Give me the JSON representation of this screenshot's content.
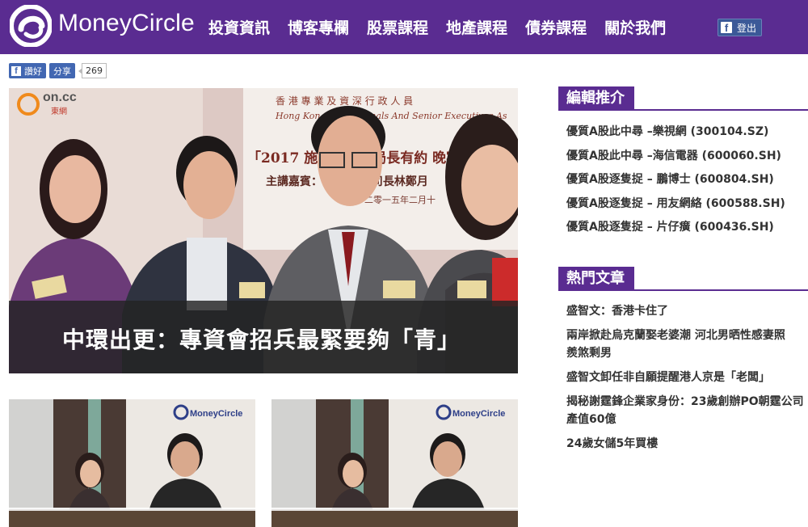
{
  "header": {
    "logo_text": "MoneyCircle",
    "nav": [
      "投資資訊",
      "博客專欄",
      "股票課程",
      "地產課程",
      "債券課程",
      "關於我們"
    ],
    "login_label": "登出"
  },
  "social": {
    "like_label": "讚好",
    "share_label": "分享",
    "share_count": "269"
  },
  "hero": {
    "title": "中環出更：專資會招兵最緊要夠「青」",
    "source_logo": "on.cc",
    "source_sub": "東網",
    "banner_line1": "香 港 專 業 及 資 深 行 政 人 員",
    "banner_line2": "Hong Kong Professionals And Senior Executives As",
    "banner_line3": "「2017 施政報告」局長有約 晚宴",
    "banner_line4": "主講嘉賓：行政長官 司長林鄭月",
    "banner_line5": "二零一五年二月十"
  },
  "thumbnails": [
    {
      "brand": "MoneyCircle"
    },
    {
      "brand": "MoneyCircle"
    }
  ],
  "sidebar": {
    "editor_title": "編輯推介",
    "editor_items": [
      "優質A股此中尋 –樂視網 (300104.SZ)",
      "優質A股此中尋 –海信電器 (600060.SH)",
      "優質A股逐隻捉 – 鵬博士 (600804.SH)",
      "優質A股逐隻捉 – 用友網絡 (600588.SH)",
      "優質A股逐隻捉 – 片仔癀 (600436.SH)"
    ],
    "hot_title": "熱門文章",
    "hot_items": [
      "盛智文：香港卡住了",
      "兩岸掀赴烏克蘭娶老婆潮 河北男晒性感妻照　羨煞剩男",
      "盛智文卸任非自願提醒港人京是「老闆」",
      "揭秘謝霆鋒企業家身份：23歲創辦PO朝霆公司產值60億",
      "24歲女儲5年買樓"
    ]
  },
  "colors": {
    "brand_purple": "#5a2c91",
    "facebook_blue": "#4267b2"
  }
}
